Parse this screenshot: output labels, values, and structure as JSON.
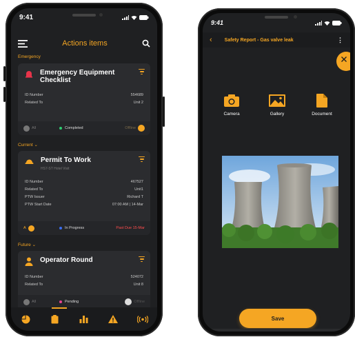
{
  "colors": {
    "accent": "#f5a623",
    "card": "#2b2c2f",
    "screen": "#1f2022",
    "completed": "#2ecc71",
    "in_progress": "#3a6df0",
    "pending": "#e84393",
    "overdue": "#ff4d4d"
  },
  "left_phone": {
    "status_time": "9:41",
    "header_title": "Actions items",
    "sections": {
      "emergency": "Emergency",
      "current": "Current",
      "future": "Future"
    },
    "cards": [
      {
        "icon": "siren-icon",
        "title": "Emergency Equipment Checklist",
        "subtitle": "",
        "rows": [
          {
            "label": "ID Number",
            "value": "554689"
          },
          {
            "label": "Related To",
            "value": "Unit 2"
          }
        ],
        "assignee": "All",
        "status": "Completed",
        "status_color": "#2ecc71",
        "tag": "Offline"
      },
      {
        "icon": "hardhat-icon",
        "title": "Permit To Work",
        "subtitle": "HS7-ST Hotel Visit",
        "rows": [
          {
            "label": "ID Number",
            "value": "467527"
          },
          {
            "label": "Related To",
            "value": "Unit1"
          },
          {
            "label": "PTW Issuer",
            "value": "Richard T"
          },
          {
            "label": "PTW Start Date",
            "value": "07:00 AM | 14-Mar"
          }
        ],
        "assignee": "A",
        "status": "In Progress",
        "status_color": "#3a6df0",
        "tag": "Past Due 15-Mar"
      },
      {
        "icon": "operator-icon",
        "title": "Operator Round",
        "subtitle": "",
        "rows": [
          {
            "label": "ID Number",
            "value": "524072"
          },
          {
            "label": "Related To",
            "value": "Unit 8"
          }
        ],
        "assignee": "All",
        "status": "Pending",
        "status_color": "#e84393",
        "tag": "Offline"
      }
    ]
  },
  "right_phone": {
    "status_time": "9:41",
    "header_title": "Safety Report - Gas valve  leak",
    "options": [
      {
        "label": "Camera",
        "icon": "camera-icon"
      },
      {
        "label": "Gallery",
        "icon": "gallery-icon"
      },
      {
        "label": "Document",
        "icon": "document-icon"
      }
    ],
    "save_label": "Save"
  }
}
